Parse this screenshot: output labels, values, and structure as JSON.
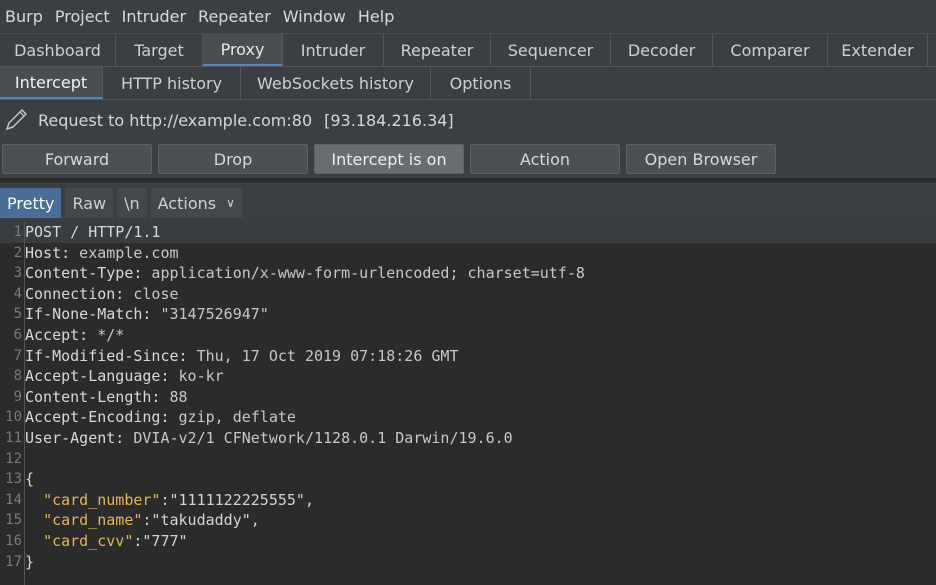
{
  "menubar": {
    "items": [
      "Burp",
      "Project",
      "Intruder",
      "Repeater",
      "Window",
      "Help"
    ]
  },
  "main_tabs": {
    "items": [
      "Dashboard",
      "Target",
      "Proxy",
      "Intruder",
      "Repeater",
      "Sequencer",
      "Decoder",
      "Comparer",
      "Extender"
    ],
    "active": "Proxy"
  },
  "proxy_tabs": {
    "items": [
      "Intercept",
      "HTTP history",
      "WebSockets history",
      "Options"
    ],
    "active": "Intercept"
  },
  "request_info": {
    "label": "Request to http://example.com:80",
    "ip": "[93.184.216.34]"
  },
  "buttons": {
    "forward": "Forward",
    "drop": "Drop",
    "intercept": "Intercept is on",
    "action": "Action",
    "open_browser": "Open Browser"
  },
  "view_bar": {
    "pretty": "Pretty",
    "raw": "Raw",
    "newline": "\\n",
    "actions": "Actions"
  },
  "request_lines": [
    {
      "num": "1",
      "name": "POST / HTTP/1.1",
      "value": ""
    },
    {
      "num": "2",
      "name": "Host:",
      "value": " example.com"
    },
    {
      "num": "3",
      "name": "Content-Type:",
      "value": " application/x-www-form-urlencoded; charset=utf-8"
    },
    {
      "num": "4",
      "name": "Connection:",
      "value": " close"
    },
    {
      "num": "5",
      "name": "If-None-Match:",
      "value": " \"3147526947\""
    },
    {
      "num": "6",
      "name": "Accept:",
      "value": " */*"
    },
    {
      "num": "7",
      "name": "If-Modified-Since:",
      "value": " Thu, 17 Oct 2019 07:18:26 GMT"
    },
    {
      "num": "8",
      "name": "Accept-Language:",
      "value": " ko-kr"
    },
    {
      "num": "9",
      "name": "Content-Length:",
      "value": " 88"
    },
    {
      "num": "10",
      "name": "Accept-Encoding:",
      "value": " gzip, deflate"
    },
    {
      "num": "11",
      "name": "User-Agent:",
      "value": " DVIA-v2/1 CFNetwork/1128.0.1 Darwin/19.6.0"
    },
    {
      "num": "12",
      "name": "",
      "value": ""
    },
    {
      "num": "13",
      "name": "{",
      "value": ""
    },
    {
      "num": "14",
      "key": "\"card_number\"",
      "value": ":\"1111122225555\","
    },
    {
      "num": "15",
      "key": "\"card_name\"",
      "value": ":\"takudaddy\","
    },
    {
      "num": "16",
      "key": "\"card_cvv\"",
      "value": ":\"777\""
    },
    {
      "num": "17",
      "name": "}",
      "value": ""
    }
  ]
}
